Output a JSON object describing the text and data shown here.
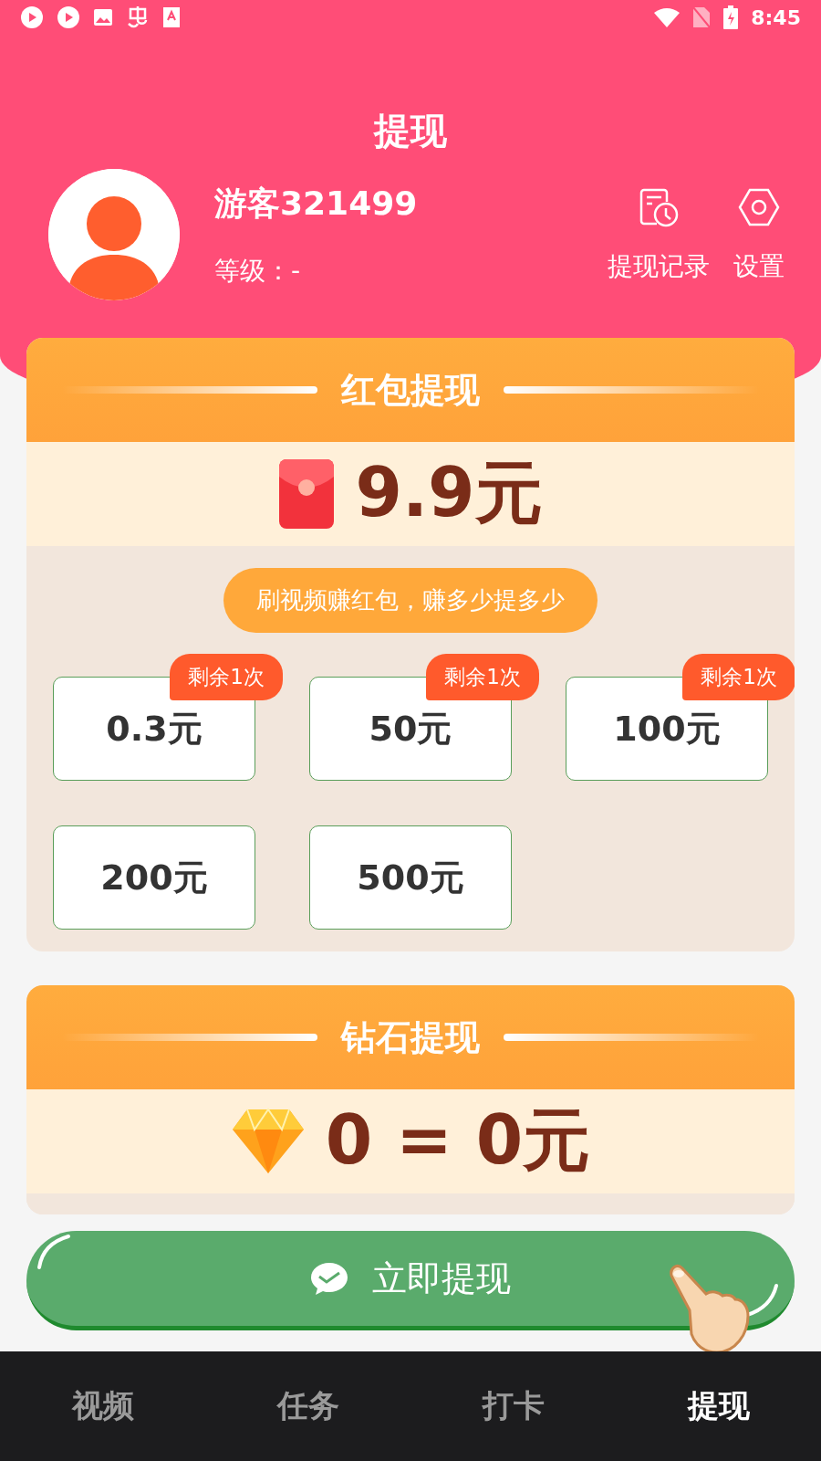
{
  "status_bar": {
    "time": "8:45"
  },
  "header": {
    "title": "提现",
    "user_name": "游客321499",
    "level": "等级：-",
    "actions": [
      {
        "kind": "history",
        "label": "提现记录"
      },
      {
        "kind": "settings",
        "label": "设置"
      }
    ]
  },
  "sections": [
    {
      "kind": "red_packet",
      "title": "红包提现",
      "amount": "9.9元",
      "slogan": "刷视频赚红包，赚多少提多少",
      "options": [
        {
          "amount": "0.3元",
          "badge": "剩余1次"
        },
        {
          "amount": "50元",
          "badge": "剩余1次"
        },
        {
          "amount": "100元",
          "badge": "剩余1次"
        },
        {
          "amount": "200元"
        },
        {
          "amount": "500元"
        }
      ]
    },
    {
      "kind": "diamond",
      "title": "钻石提现",
      "amount": "0 = 0元"
    }
  ],
  "withdraw_button": {
    "label": "立即提现"
  },
  "nav": [
    {
      "label": "视频",
      "selected": false
    },
    {
      "label": "任务",
      "selected": false
    },
    {
      "label": "打卡",
      "selected": false
    },
    {
      "label": "提现",
      "selected": true
    }
  ]
}
